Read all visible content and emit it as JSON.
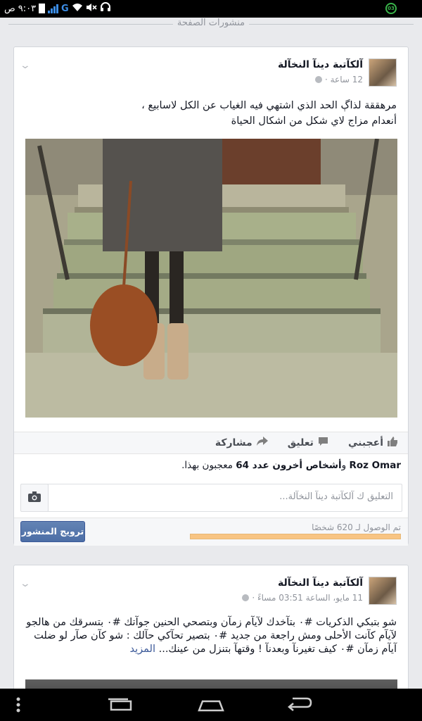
{
  "status_bar": {
    "time": "٩:٠٣",
    "am_pm": "ص",
    "network": "G",
    "badge": "03"
  },
  "section": {
    "title": "منشورات الصفحة"
  },
  "post1": {
    "page_name": "آلكآتبة دينآ النخآلة",
    "time": "12 ساعة ·",
    "text_line1": "مرهققة لذاڳ الحد الذي اشتهي فيه الغياب عن الكل لاسابيع ،",
    "text_line2": "أنعدام مزاج لاي شكل من اشكال الحياة",
    "actions": {
      "like": "أعجبني",
      "comment": "تعليق",
      "share": "مشاركة"
    },
    "likes_name": "Roz Omar",
    "likes_connector": " و",
    "likes_others": "أشخاص أخرون عدد 64",
    "likes_suffix": " معجبون بهذا.",
    "comment_placeholder": "التعليق ك آلكآتبة دينآ النخآلة...",
    "reach_text": "تم الوصول لـ 620 شخصًا",
    "reach_fraction": 1.0,
    "boost_label": "ترويج المنشور"
  },
  "post2": {
    "page_name": "آلكآتبة دينآ النخآلة",
    "time": "11 مايو، الساعة 03:51 مساءً ·",
    "text": "شو بتبكي الذكريات #٠ بتآخدك لآيآم زمآن وبتصحي الحنين جوآتك #٠ بتسرقك من هالجو لآيآم كآنت الأحلى ومش راجعة من جديد #٠ بتصير تحآكي حآلك : شو كآن صآر لو ضلت آيآم زمآن #٠ كيف تغيرنآ وبعدنآ ! وقتهآ بتنزل من عينك...",
    "see_more": "المزيد"
  },
  "colors": {
    "brand": "#3b5998",
    "background": "#e9eaed",
    "reach_bar": "#f8c483"
  },
  "icons": [
    "battery-icon",
    "signal-icon",
    "wifi-icon",
    "mute-icon",
    "headset-icon",
    "globe-icon",
    "chevron-down-icon",
    "like-icon",
    "comment-icon",
    "share-icon",
    "camera-icon",
    "menu-dots-icon",
    "recent-apps-icon",
    "home-icon",
    "back-icon"
  ]
}
